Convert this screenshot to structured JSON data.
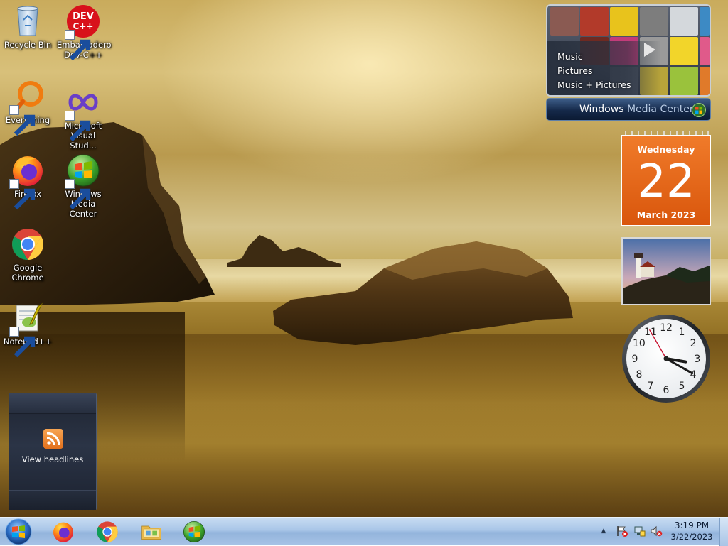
{
  "desktop": {
    "icons": [
      {
        "label": "Recycle Bin",
        "icon": "recycle-bin-icon"
      },
      {
        "label": "Embarcadero Dev-C++",
        "icon": "devcpp-icon"
      },
      {
        "label": "Everything",
        "icon": "everything-icon"
      },
      {
        "label": "Microsoft Visual Stud...",
        "icon": "visual-studio-icon"
      },
      {
        "label": "Firefox",
        "icon": "firefox-icon"
      },
      {
        "label": "Windows Media Center",
        "icon": "windows-media-center-icon"
      },
      {
        "label": "Google Chrome",
        "icon": "chrome-icon"
      },
      {
        "label": "Notepad++",
        "icon": "notepadpp-icon"
      }
    ],
    "devcpp_badge": "DEV C++"
  },
  "gadgets": {
    "media_center": {
      "menu": [
        "Music",
        "Pictures",
        "Music + Pictures"
      ],
      "title_bold": "Windows",
      "title_rest": "Media Center"
    },
    "calendar": {
      "weekday": "Wednesday",
      "day": "22",
      "month_year": "March 2023"
    },
    "clock": {
      "numerals": [
        "12",
        "1",
        "2",
        "3",
        "4",
        "5",
        "6",
        "7",
        "8",
        "9",
        "10",
        "11"
      ],
      "hour": 3,
      "minute": 19,
      "second": 55
    },
    "feed": {
      "text": "View headlines"
    }
  },
  "taskbar": {
    "pinned": [
      "firefox-icon",
      "chrome-icon",
      "file-explorer-icon",
      "windows-media-center-icon"
    ],
    "tray": {
      "time": "3:19 PM",
      "date": "3/22/2023"
    }
  },
  "colors": {
    "calendar_orange": "#e8661a",
    "taskbar_blue": "#a9c6e8"
  }
}
